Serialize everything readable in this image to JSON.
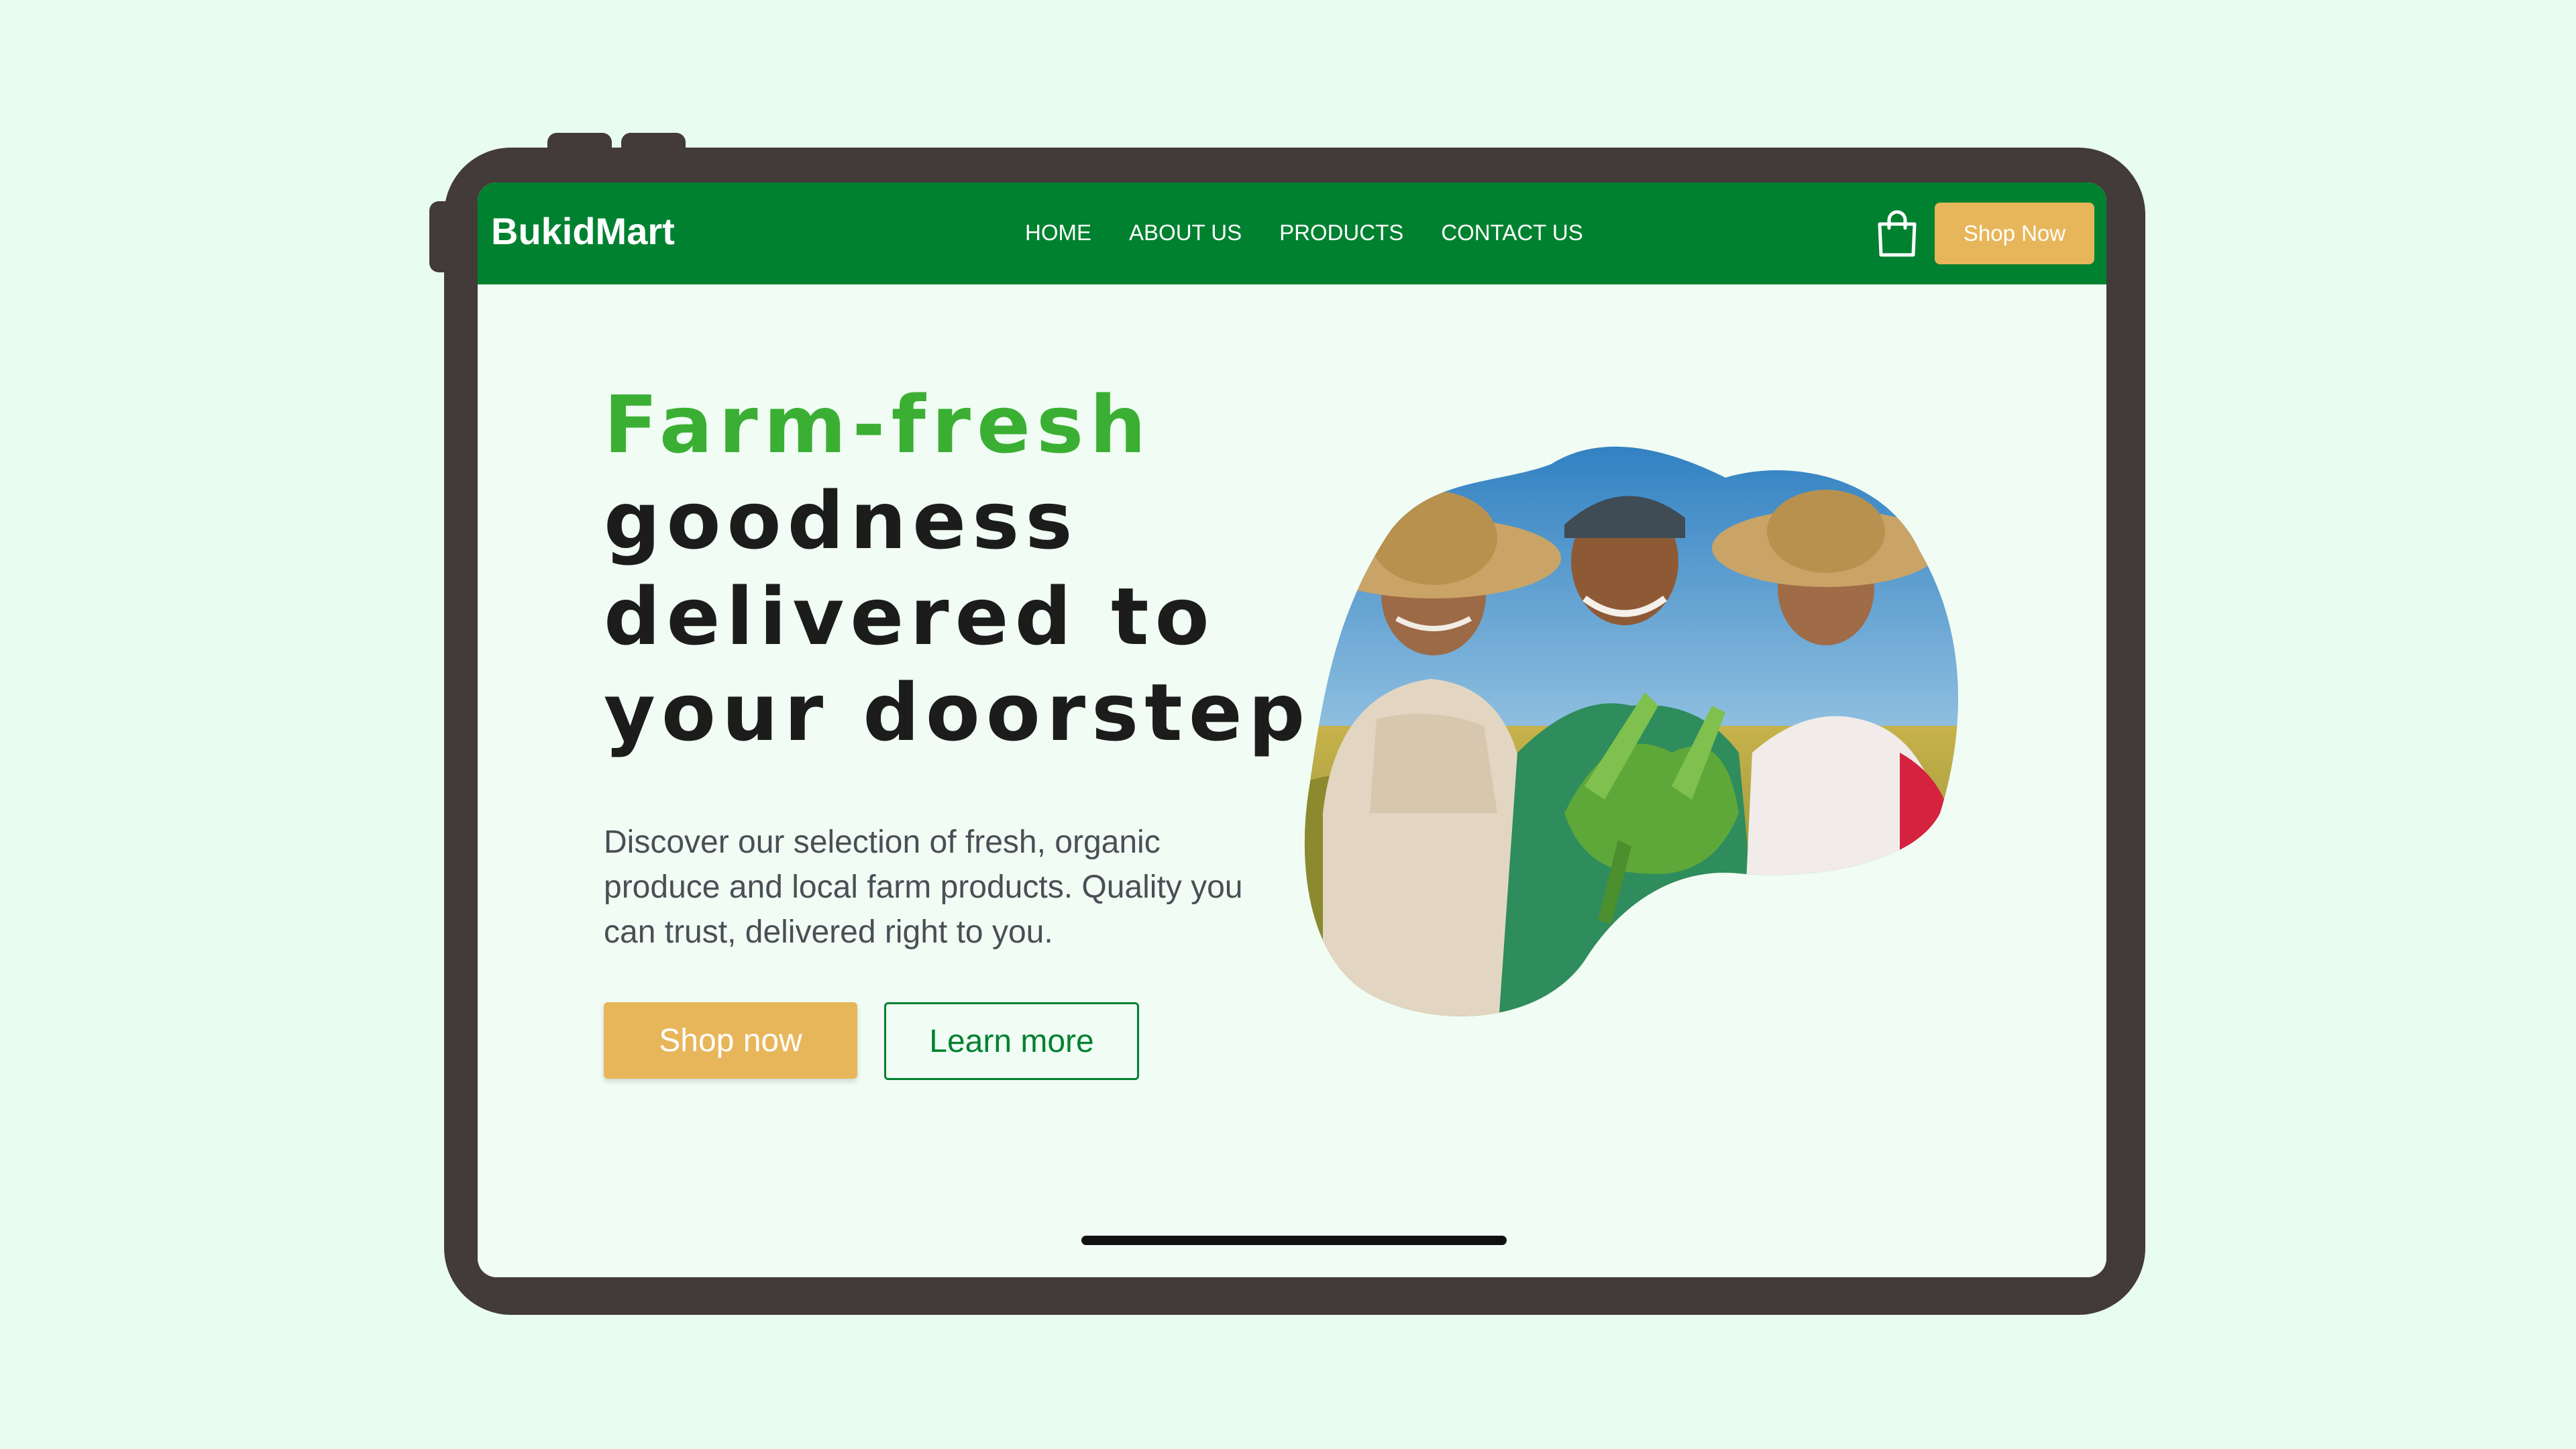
{
  "navbar": {
    "logo": "BukidMart",
    "links": [
      "HOME",
      "ABOUT US",
      "PRODUCTS",
      "CONTACT US"
    ],
    "cta_label": "Shop Now",
    "cart_icon": "shopping-bag-icon"
  },
  "hero": {
    "title_accent": "Farm-fresh",
    "title_lines": [
      "goodness",
      "delivered to",
      "your doorstep"
    ],
    "description": "Discover our selection of fresh, organic produce and local farm products. Quality you can trust, delivered right to you.",
    "primary_button": "Shop now",
    "secondary_button": "Learn more"
  },
  "colors": {
    "page_background": "#E8FDEF",
    "device_frame": "#433A3A",
    "navbar": "#008130",
    "accent_yellow": "#E8B65A",
    "title_green": "#3BAF33",
    "screen_background": "#F0FCF4"
  }
}
